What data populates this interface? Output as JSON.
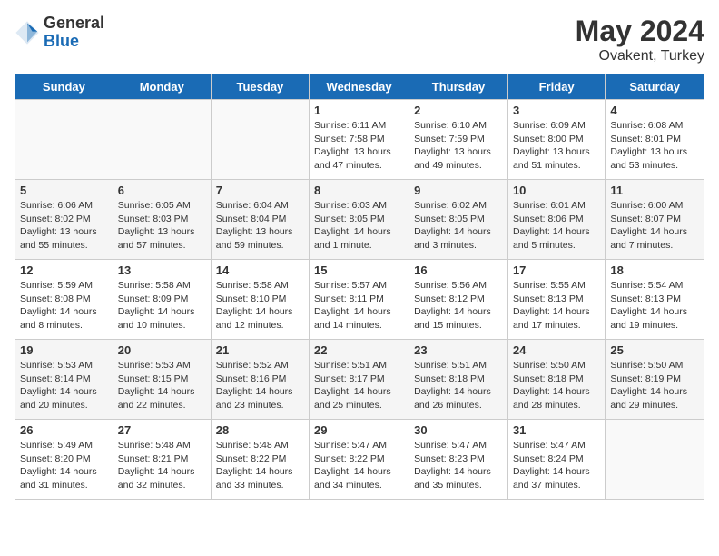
{
  "logo": {
    "general": "General",
    "blue": "Blue"
  },
  "title": {
    "month_year": "May 2024",
    "location": "Ovakent, Turkey"
  },
  "weekdays": [
    "Sunday",
    "Monday",
    "Tuesday",
    "Wednesday",
    "Thursday",
    "Friday",
    "Saturday"
  ],
  "rows": [
    [
      {
        "day": "",
        "empty": true
      },
      {
        "day": "",
        "empty": true
      },
      {
        "day": "",
        "empty": true
      },
      {
        "day": "1",
        "sunrise": "Sunrise: 6:11 AM",
        "sunset": "Sunset: 7:58 PM",
        "daylight": "Daylight: 13 hours and 47 minutes."
      },
      {
        "day": "2",
        "sunrise": "Sunrise: 6:10 AM",
        "sunset": "Sunset: 7:59 PM",
        "daylight": "Daylight: 13 hours and 49 minutes."
      },
      {
        "day": "3",
        "sunrise": "Sunrise: 6:09 AM",
        "sunset": "Sunset: 8:00 PM",
        "daylight": "Daylight: 13 hours and 51 minutes."
      },
      {
        "day": "4",
        "sunrise": "Sunrise: 6:08 AM",
        "sunset": "Sunset: 8:01 PM",
        "daylight": "Daylight: 13 hours and 53 minutes."
      }
    ],
    [
      {
        "day": "5",
        "sunrise": "Sunrise: 6:06 AM",
        "sunset": "Sunset: 8:02 PM",
        "daylight": "Daylight: 13 hours and 55 minutes."
      },
      {
        "day": "6",
        "sunrise": "Sunrise: 6:05 AM",
        "sunset": "Sunset: 8:03 PM",
        "daylight": "Daylight: 13 hours and 57 minutes."
      },
      {
        "day": "7",
        "sunrise": "Sunrise: 6:04 AM",
        "sunset": "Sunset: 8:04 PM",
        "daylight": "Daylight: 13 hours and 59 minutes."
      },
      {
        "day": "8",
        "sunrise": "Sunrise: 6:03 AM",
        "sunset": "Sunset: 8:05 PM",
        "daylight": "Daylight: 14 hours and 1 minute."
      },
      {
        "day": "9",
        "sunrise": "Sunrise: 6:02 AM",
        "sunset": "Sunset: 8:05 PM",
        "daylight": "Daylight: 14 hours and 3 minutes."
      },
      {
        "day": "10",
        "sunrise": "Sunrise: 6:01 AM",
        "sunset": "Sunset: 8:06 PM",
        "daylight": "Daylight: 14 hours and 5 minutes."
      },
      {
        "day": "11",
        "sunrise": "Sunrise: 6:00 AM",
        "sunset": "Sunset: 8:07 PM",
        "daylight": "Daylight: 14 hours and 7 minutes."
      }
    ],
    [
      {
        "day": "12",
        "sunrise": "Sunrise: 5:59 AM",
        "sunset": "Sunset: 8:08 PM",
        "daylight": "Daylight: 14 hours and 8 minutes."
      },
      {
        "day": "13",
        "sunrise": "Sunrise: 5:58 AM",
        "sunset": "Sunset: 8:09 PM",
        "daylight": "Daylight: 14 hours and 10 minutes."
      },
      {
        "day": "14",
        "sunrise": "Sunrise: 5:58 AM",
        "sunset": "Sunset: 8:10 PM",
        "daylight": "Daylight: 14 hours and 12 minutes."
      },
      {
        "day": "15",
        "sunrise": "Sunrise: 5:57 AM",
        "sunset": "Sunset: 8:11 PM",
        "daylight": "Daylight: 14 hours and 14 minutes."
      },
      {
        "day": "16",
        "sunrise": "Sunrise: 5:56 AM",
        "sunset": "Sunset: 8:12 PM",
        "daylight": "Daylight: 14 hours and 15 minutes."
      },
      {
        "day": "17",
        "sunrise": "Sunrise: 5:55 AM",
        "sunset": "Sunset: 8:13 PM",
        "daylight": "Daylight: 14 hours and 17 minutes."
      },
      {
        "day": "18",
        "sunrise": "Sunrise: 5:54 AM",
        "sunset": "Sunset: 8:13 PM",
        "daylight": "Daylight: 14 hours and 19 minutes."
      }
    ],
    [
      {
        "day": "19",
        "sunrise": "Sunrise: 5:53 AM",
        "sunset": "Sunset: 8:14 PM",
        "daylight": "Daylight: 14 hours and 20 minutes."
      },
      {
        "day": "20",
        "sunrise": "Sunrise: 5:53 AM",
        "sunset": "Sunset: 8:15 PM",
        "daylight": "Daylight: 14 hours and 22 minutes."
      },
      {
        "day": "21",
        "sunrise": "Sunrise: 5:52 AM",
        "sunset": "Sunset: 8:16 PM",
        "daylight": "Daylight: 14 hours and 23 minutes."
      },
      {
        "day": "22",
        "sunrise": "Sunrise: 5:51 AM",
        "sunset": "Sunset: 8:17 PM",
        "daylight": "Daylight: 14 hours and 25 minutes."
      },
      {
        "day": "23",
        "sunrise": "Sunrise: 5:51 AM",
        "sunset": "Sunset: 8:18 PM",
        "daylight": "Daylight: 14 hours and 26 minutes."
      },
      {
        "day": "24",
        "sunrise": "Sunrise: 5:50 AM",
        "sunset": "Sunset: 8:18 PM",
        "daylight": "Daylight: 14 hours and 28 minutes."
      },
      {
        "day": "25",
        "sunrise": "Sunrise: 5:50 AM",
        "sunset": "Sunset: 8:19 PM",
        "daylight": "Daylight: 14 hours and 29 minutes."
      }
    ],
    [
      {
        "day": "26",
        "sunrise": "Sunrise: 5:49 AM",
        "sunset": "Sunset: 8:20 PM",
        "daylight": "Daylight: 14 hours and 31 minutes."
      },
      {
        "day": "27",
        "sunrise": "Sunrise: 5:48 AM",
        "sunset": "Sunset: 8:21 PM",
        "daylight": "Daylight: 14 hours and 32 minutes."
      },
      {
        "day": "28",
        "sunrise": "Sunrise: 5:48 AM",
        "sunset": "Sunset: 8:22 PM",
        "daylight": "Daylight: 14 hours and 33 minutes."
      },
      {
        "day": "29",
        "sunrise": "Sunrise: 5:47 AM",
        "sunset": "Sunset: 8:22 PM",
        "daylight": "Daylight: 14 hours and 34 minutes."
      },
      {
        "day": "30",
        "sunrise": "Sunrise: 5:47 AM",
        "sunset": "Sunset: 8:23 PM",
        "daylight": "Daylight: 14 hours and 35 minutes."
      },
      {
        "day": "31",
        "sunrise": "Sunrise: 5:47 AM",
        "sunset": "Sunset: 8:24 PM",
        "daylight": "Daylight: 14 hours and 37 minutes."
      },
      {
        "day": "",
        "empty": true
      }
    ]
  ]
}
